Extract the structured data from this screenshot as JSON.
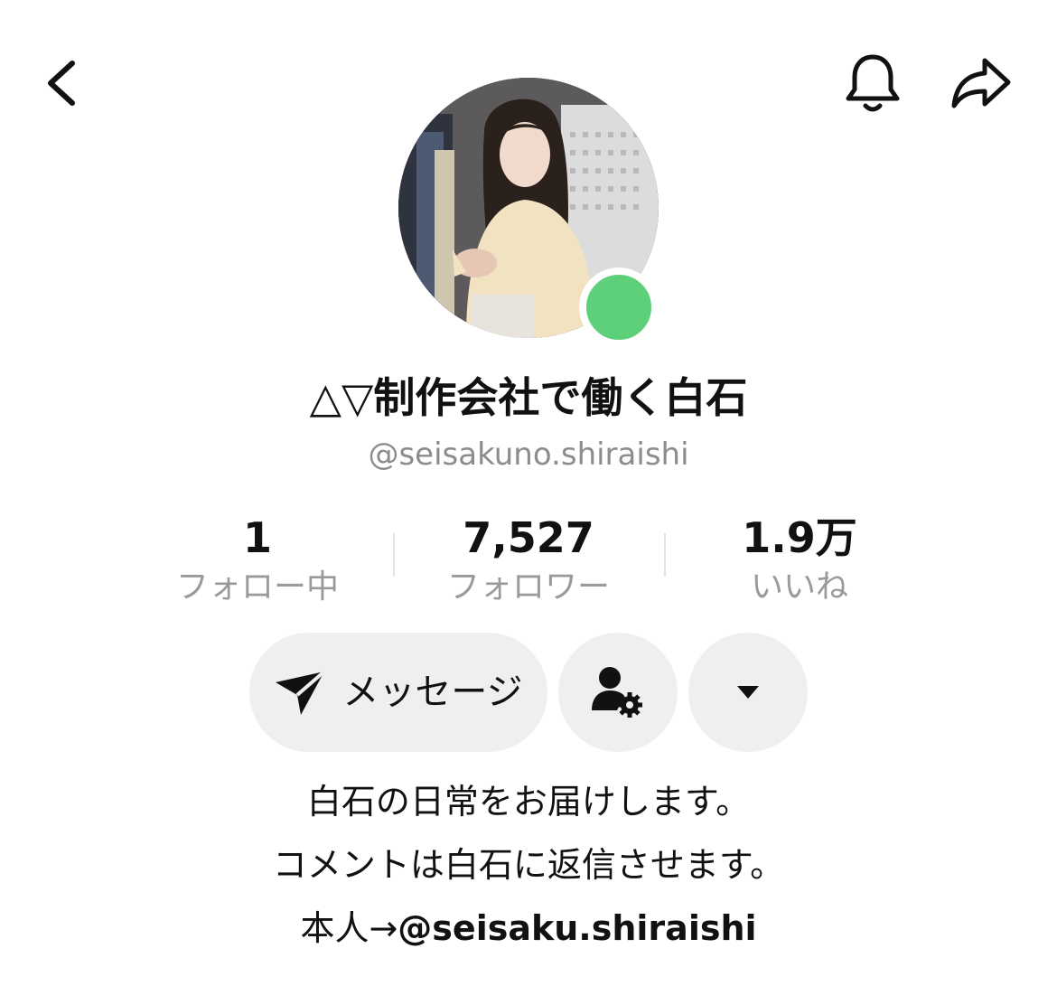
{
  "header": {
    "back_icon": "chevron-left-icon",
    "bell_icon": "bell-icon",
    "share_icon": "share-arrow-icon"
  },
  "profile": {
    "display_name": "△▽制作会社で働く白石",
    "handle": "@seisakuno.shiraishi",
    "online": true,
    "online_color": "#5fd07a"
  },
  "stats": [
    {
      "value": "1",
      "label": "フォロー中"
    },
    {
      "value": "7,527",
      "label": "フォロワー"
    },
    {
      "value": "1.9万",
      "label": "いいね"
    }
  ],
  "actions": {
    "message_label": "メッセージ",
    "message_icon": "send-icon",
    "settings_icon": "user-settings-icon",
    "more_icon": "caret-down-icon"
  },
  "bio": {
    "line1": "白石の日常をお届けします。",
    "line2": "コメントは白石に返信させます。",
    "line3_prefix": "本人→",
    "line3_handle": "@seisaku.shiraishi"
  }
}
